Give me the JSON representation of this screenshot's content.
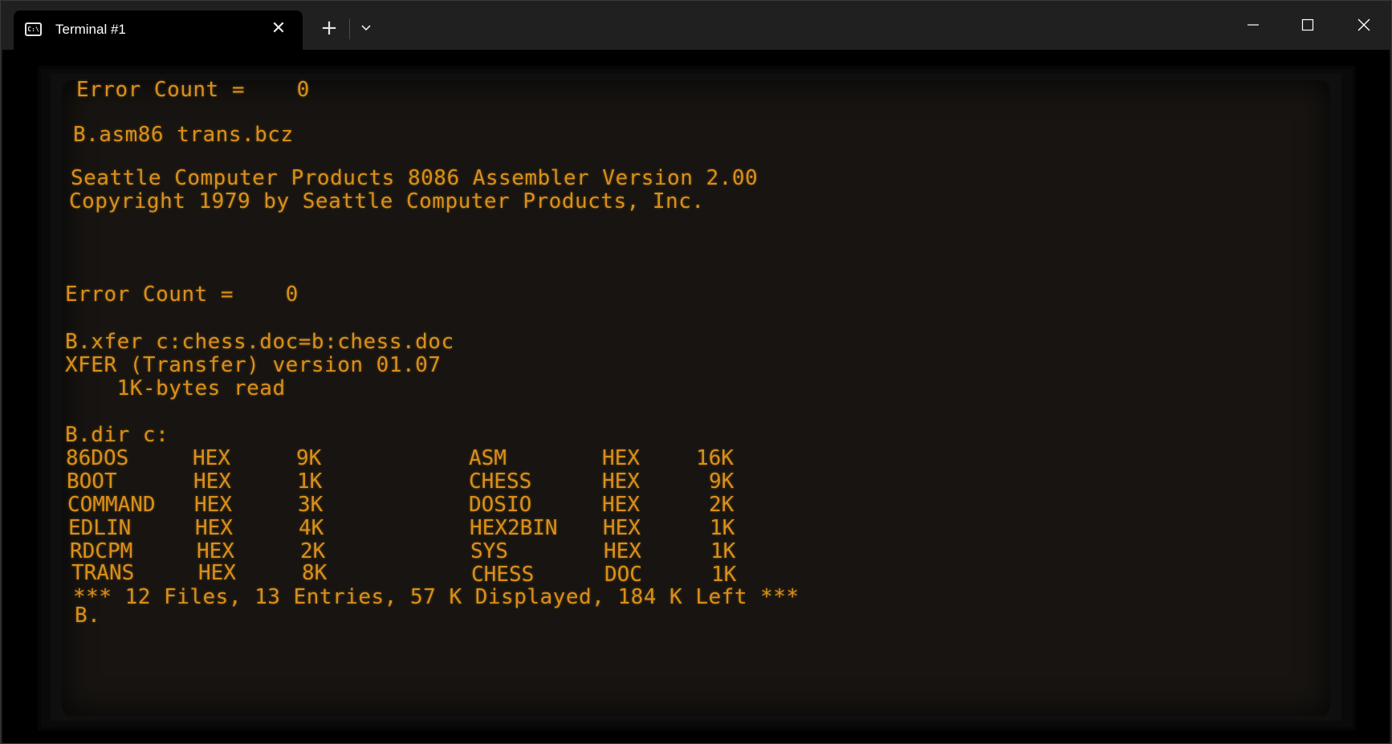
{
  "tab": {
    "icon": "terminal-icon",
    "icon_glyph": "C:\\",
    "title": "Terminal #1",
    "close_glyph": "✕"
  },
  "tabbar": {
    "new_tab_glyph": "+"
  },
  "terminal": {
    "text_color": "#d98f1a",
    "lines": {
      "error1": "Error Count =    0",
      "asm_cmd": "B.asm86 trans.bcz",
      "asm_title": "Seattle Computer Products 8086 Assembler Version 2.00",
      "asm_copyright": "Copyright 1979 by Seattle Computer Products, Inc.",
      "error2": "Error Count =    0",
      "xfer_cmd": "B.xfer c:chess.doc=b:chess.doc",
      "xfer_version": "XFER (Transfer) version 01.07",
      "xfer_read": "    1K-bytes read",
      "dir_cmd": "B.dir c:",
      "summary": "*** 12 Files, 13 Entries, 57 K Displayed, 184 K Left ***",
      "prompt": "B."
    },
    "dir_left": [
      {
        "name": "86DOS",
        "ext": "HEX",
        "size": "9K"
      },
      {
        "name": "BOOT",
        "ext": "HEX",
        "size": "1K"
      },
      {
        "name": "COMMAND",
        "ext": "HEX",
        "size": "3K"
      },
      {
        "name": "EDLIN",
        "ext": "HEX",
        "size": "4K"
      },
      {
        "name": "RDCPM",
        "ext": "HEX",
        "size": "2K"
      },
      {
        "name": "TRANS",
        "ext": "HEX",
        "size": "8K"
      }
    ],
    "dir_right": [
      {
        "name": "ASM",
        "ext": "HEX",
        "size": "16K"
      },
      {
        "name": "CHESS",
        "ext": "HEX",
        "size": "9K"
      },
      {
        "name": "DOSIO",
        "ext": "HEX",
        "size": "2K"
      },
      {
        "name": "HEX2BIN",
        "ext": "HEX",
        "size": "1K"
      },
      {
        "name": "SYS",
        "ext": "HEX",
        "size": "1K"
      },
      {
        "name": "CHESS",
        "ext": "DOC",
        "size": "1K"
      }
    ]
  }
}
